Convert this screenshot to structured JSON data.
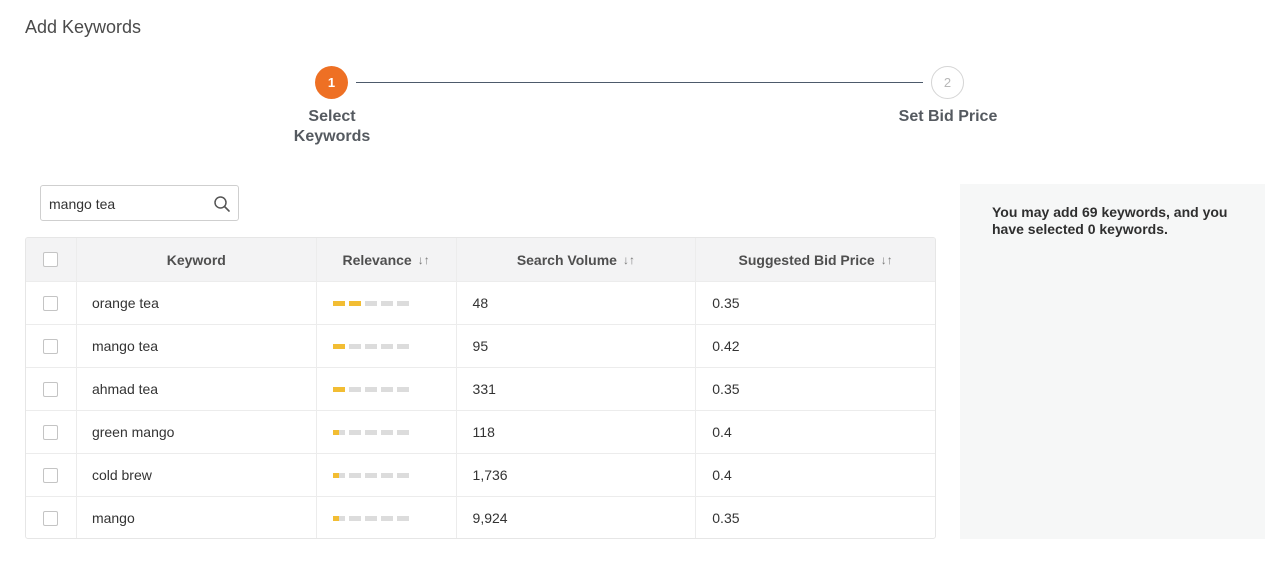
{
  "page": {
    "title": "Add Keywords"
  },
  "stepper": {
    "steps": [
      {
        "number": "1",
        "label": "Select\nKeywords",
        "active": true
      },
      {
        "number": "2",
        "label": "Set Bid Price",
        "active": false
      }
    ],
    "accent_color": "#ee7024"
  },
  "search": {
    "value": "mango tea",
    "icon": "search-icon"
  },
  "table": {
    "headers": {
      "keyword": "Keyword",
      "relevance": "Relevance",
      "search_volume": "Search Volume",
      "suggested_bid": "Suggested Bid Price",
      "sort_icon": "sort-icon"
    },
    "relevance_max": 5,
    "rows": [
      {
        "keyword": "orange tea",
        "relevance": 2,
        "search_volume": "48",
        "suggested_bid": "0.35",
        "checked": false
      },
      {
        "keyword": "mango tea",
        "relevance": 1,
        "search_volume": "95",
        "suggested_bid": "0.42",
        "checked": false
      },
      {
        "keyword": "ahmad tea",
        "relevance": 1,
        "search_volume": "331",
        "suggested_bid": "0.35",
        "checked": false
      },
      {
        "keyword": "green mango",
        "relevance": 0.5,
        "search_volume": "118",
        "suggested_bid": "0.4",
        "checked": false
      },
      {
        "keyword": "cold brew",
        "relevance": 0.5,
        "search_volume": "1,736",
        "suggested_bid": "0.4",
        "checked": false
      },
      {
        "keyword": "mango",
        "relevance": 0.5,
        "search_volume": "9,924",
        "suggested_bid": "0.35",
        "checked": false
      }
    ]
  },
  "side_panel": {
    "message": "You may add 69 keywords, and you have selected 0 keywords."
  },
  "colors": {
    "relevance_bar": "#f2bd33",
    "relevance_empty": "#dcdcdc"
  }
}
